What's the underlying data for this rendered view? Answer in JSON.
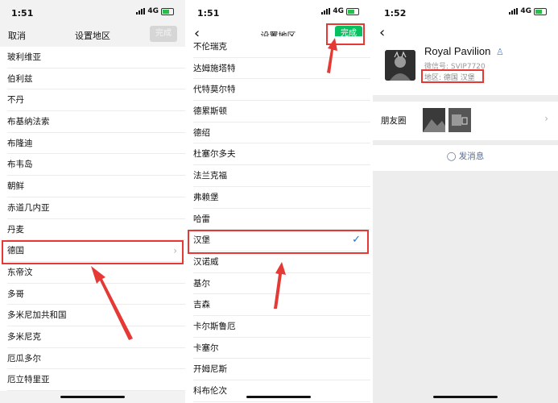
{
  "panel1": {
    "status": {
      "time": "1:51",
      "network": "4G"
    },
    "nav": {
      "cancel": "取消",
      "title": "设置地区",
      "done": "完成"
    },
    "items": [
      "玻利维亚",
      "伯利兹",
      "不丹",
      "布基纳法索",
      "布隆迪",
      "布韦岛",
      "朝鲜",
      "赤道几内亚",
      "丹麦",
      "德国",
      "东帝汶",
      "多哥",
      "多米尼加共和国",
      "多米尼克",
      "厄瓜多尔",
      "厄立特里亚"
    ],
    "selected": "德国"
  },
  "panel2": {
    "status": {
      "time": "1:51",
      "network": "4G"
    },
    "nav": {
      "back": "‹",
      "title": "设置地区",
      "done": "完成"
    },
    "cut_item": "不伦瑞克",
    "items": [
      "达姆施塔特",
      "代特莫尔特",
      "德累斯顿",
      "德绍",
      "杜塞尔多夫",
      "法兰克福",
      "弗赖堡",
      "哈雷",
      "汉堡",
      "汉诺威",
      "基尔",
      "吉森",
      "卡尔斯鲁厄",
      "卡塞尔",
      "开姆尼斯",
      "科布伦次"
    ],
    "selected": "汉堡"
  },
  "panel3": {
    "status": {
      "time": "1:52",
      "network": "4G"
    },
    "nav": {
      "back": "‹"
    },
    "profile": {
      "name": "Royal Pavilion",
      "wechat_id": "微信号: SVIP7720",
      "region": "地区: 德国 汉堡"
    },
    "moments_label": "朋友圈",
    "send_message": "发消息"
  },
  "colors": {
    "accent_green": "#07c160",
    "highlight_red": "#e53935",
    "check_blue": "#1a73e8",
    "link_blue": "#576b95"
  },
  "icons": [
    "back-icon",
    "chevron-right-icon",
    "check-icon",
    "person-icon",
    "chat-bubble-icon",
    "signal-icon",
    "battery-icon",
    "arrow-annotation"
  ]
}
